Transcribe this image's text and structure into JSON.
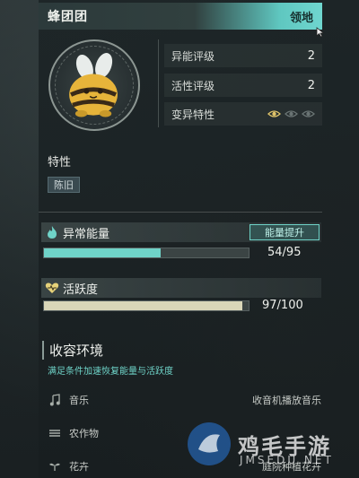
{
  "header": {
    "name": "蜂团团",
    "domain_label": "领地"
  },
  "stats": {
    "ability_rating": {
      "label": "异能评级",
      "value": "2"
    },
    "activity_rating": {
      "label": "活性评级",
      "value": "2"
    },
    "mutation": {
      "label": "变异特性",
      "eyes_active": 1,
      "eyes_total": 3
    }
  },
  "traits": {
    "title": "特性",
    "tags": [
      "陈旧"
    ]
  },
  "energy": {
    "label": "异常能量",
    "boost_label": "能量提升",
    "current": 54,
    "max": 95,
    "value_text": "54/95",
    "color": "#6fd3c8"
  },
  "activity": {
    "label": "活跃度",
    "current": 97,
    "max": 100,
    "value_text": "97/100",
    "color": "#d9d6b8"
  },
  "containment": {
    "title": "收容环境",
    "subtitle": "满足条件加速恢复能量与活跃度",
    "rows": [
      {
        "icon": "music-note-icon",
        "label": "音乐",
        "requirement": "收音机播放音乐"
      },
      {
        "icon": "crops-icon",
        "label": "农作物",
        "requirement": ""
      },
      {
        "icon": "flower-icon",
        "label": "花卉",
        "requirement": "庭院种植花卉"
      }
    ]
  },
  "watermark": {
    "text": "鸡毛手游",
    "sub": "JMSEDU.NET"
  }
}
